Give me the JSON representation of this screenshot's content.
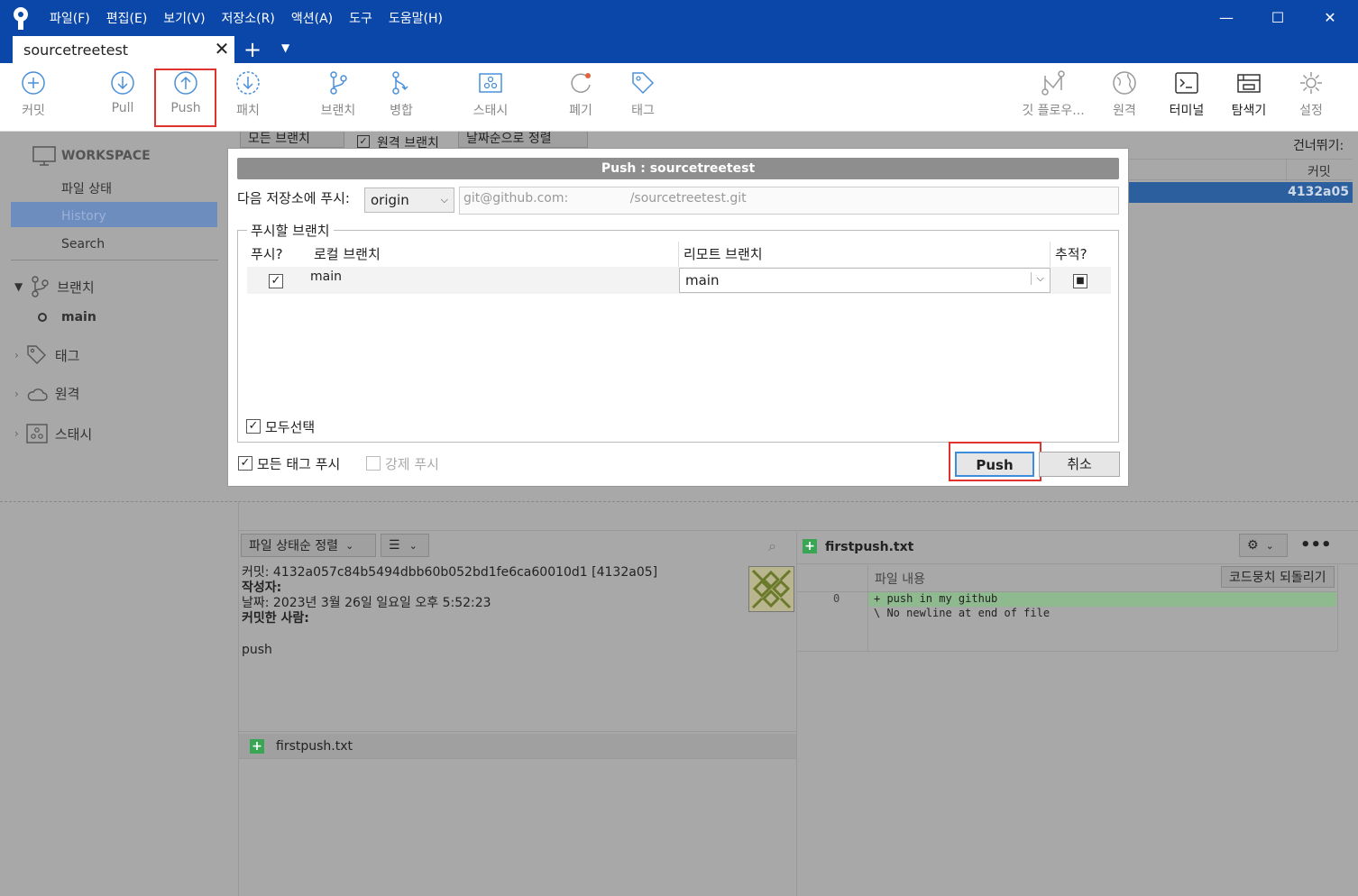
{
  "window": {
    "menu": [
      "파일(F)",
      "편집(E)",
      "보기(V)",
      "저장소(R)",
      "액션(A)",
      "도구",
      "도움말(H)"
    ],
    "tab_title": "sourcetreetest"
  },
  "toolbar": {
    "items": [
      {
        "label": "커밋",
        "icon": "plus-circle-icon"
      },
      {
        "label": "Pull",
        "icon": "arrow-down-circle-icon"
      },
      {
        "label": "Push",
        "icon": "arrow-up-circle-icon"
      },
      {
        "label": "패치",
        "icon": "download-dashed-icon"
      },
      {
        "label": "브랜치",
        "icon": "branch-icon"
      },
      {
        "label": "병합",
        "icon": "merge-icon"
      },
      {
        "label": "스태시",
        "icon": "stash-icon"
      },
      {
        "label": "폐기",
        "icon": "discard-icon"
      },
      {
        "label": "태그",
        "icon": "tag-icon"
      },
      {
        "label": "깃 플로우...",
        "icon": "git-flow-icon"
      },
      {
        "label": "원격",
        "icon": "globe-icon"
      },
      {
        "label": "터미널",
        "icon": "terminal-icon"
      },
      {
        "label": "탐색기",
        "icon": "explorer-icon"
      },
      {
        "label": "설정",
        "icon": "gear-icon"
      }
    ]
  },
  "sidebar": {
    "workspace": "WORKSPACE",
    "items": [
      "파일 상태",
      "History",
      "Search"
    ],
    "branches_label": "브랜치",
    "current_branch": "main",
    "tags_label": "태그",
    "remotes_label": "원격",
    "stash_label": "스태시"
  },
  "background": {
    "filter_branches": "모든 브랜치",
    "remote_branches": "원격 브랜치",
    "sort_by_date": "날짜순으로 정렬",
    "skip_label": "건너뛰기:",
    "commit_col": "커밋",
    "commit_short": "4132a05",
    "file_sort": "파일 상태순 정렬",
    "commit_line": "커밋: 4132a057c84b5494dbb60b052bd1fe6ca60010d1 [4132a05]",
    "author_label": "작성자:",
    "date_line": "날짜: 2023년 3월 26일 일요일 오후 5:52:23",
    "committer_label": "커밋한 사람:",
    "message": "push",
    "file_name": "firstpush.txt",
    "diff_file": "firstpush.txt",
    "file_content_label": "파일 내용",
    "revert_hunk": "코드뭉치 되돌리기",
    "diff_line_no": "0",
    "diff_lines": [
      "+ push in my github",
      "\\  No newline at end of file"
    ]
  },
  "dialog": {
    "title": "Push :  sourcetreetest",
    "push_to_label": "다음 저장소에 푸시:",
    "remote": "origin",
    "url_prefix": "git@github.com:",
    "url_suffix": "/sourcetreetest.git",
    "branches_group": "푸시할 브랜치",
    "col_push": "푸시?",
    "col_local": "로컬 브랜치",
    "col_remote": "리모트 브랜치",
    "col_track": "추적?",
    "row_local": "main",
    "row_remote": "main",
    "select_all": "모두선택",
    "push_all_tags": "모든 태그 푸시",
    "force_push": "강제 푸시",
    "push_button": "Push",
    "cancel_button": "취소"
  },
  "colors": {
    "titlebar": "#0b47a8",
    "highlight": "#e0332e",
    "sidebar_active": "#6d8dbf",
    "primary_button_border": "#3c8ddc"
  }
}
